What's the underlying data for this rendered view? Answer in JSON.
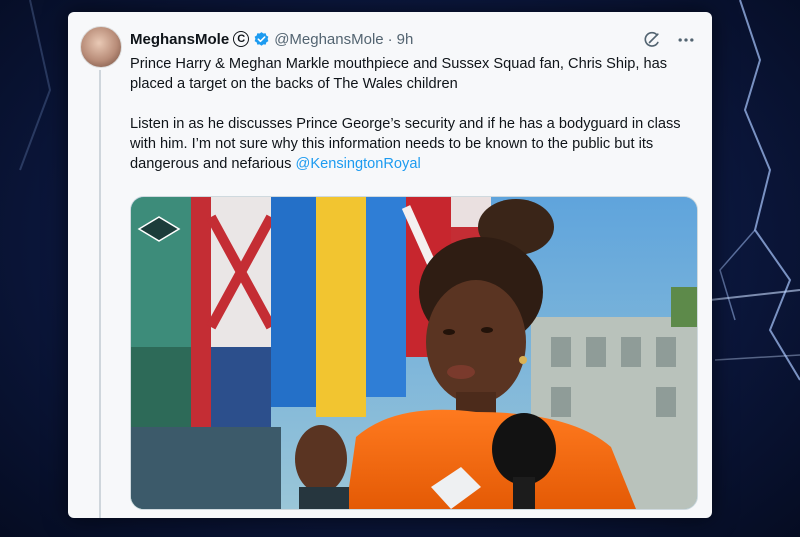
{
  "tweet": {
    "display_name": "MeghansMole",
    "name_badge": "C",
    "handle": "@MeghansMole",
    "separator": "·",
    "time": "9h",
    "more_icon": "more-horizontal-icon",
    "grok_icon": "grok-icon",
    "paragraph1": "Prince Harry & Meghan Markle mouthpiece and Sussex Squad fan, Chris Ship, has placed a target on the backs of The Wales children",
    "paragraph2_text": "Listen in as he discusses Prince George’s security and if he has a bodyguard in class with him. I’m not sure why this information needs to be known to the public but its dangerous and nefarious ",
    "mention": "@KensingtonRoyal"
  },
  "colors": {
    "accent": "#1d9bf0",
    "text": "#0f1419",
    "muted": "#536471",
    "orange_top": "#ff7a1f"
  }
}
